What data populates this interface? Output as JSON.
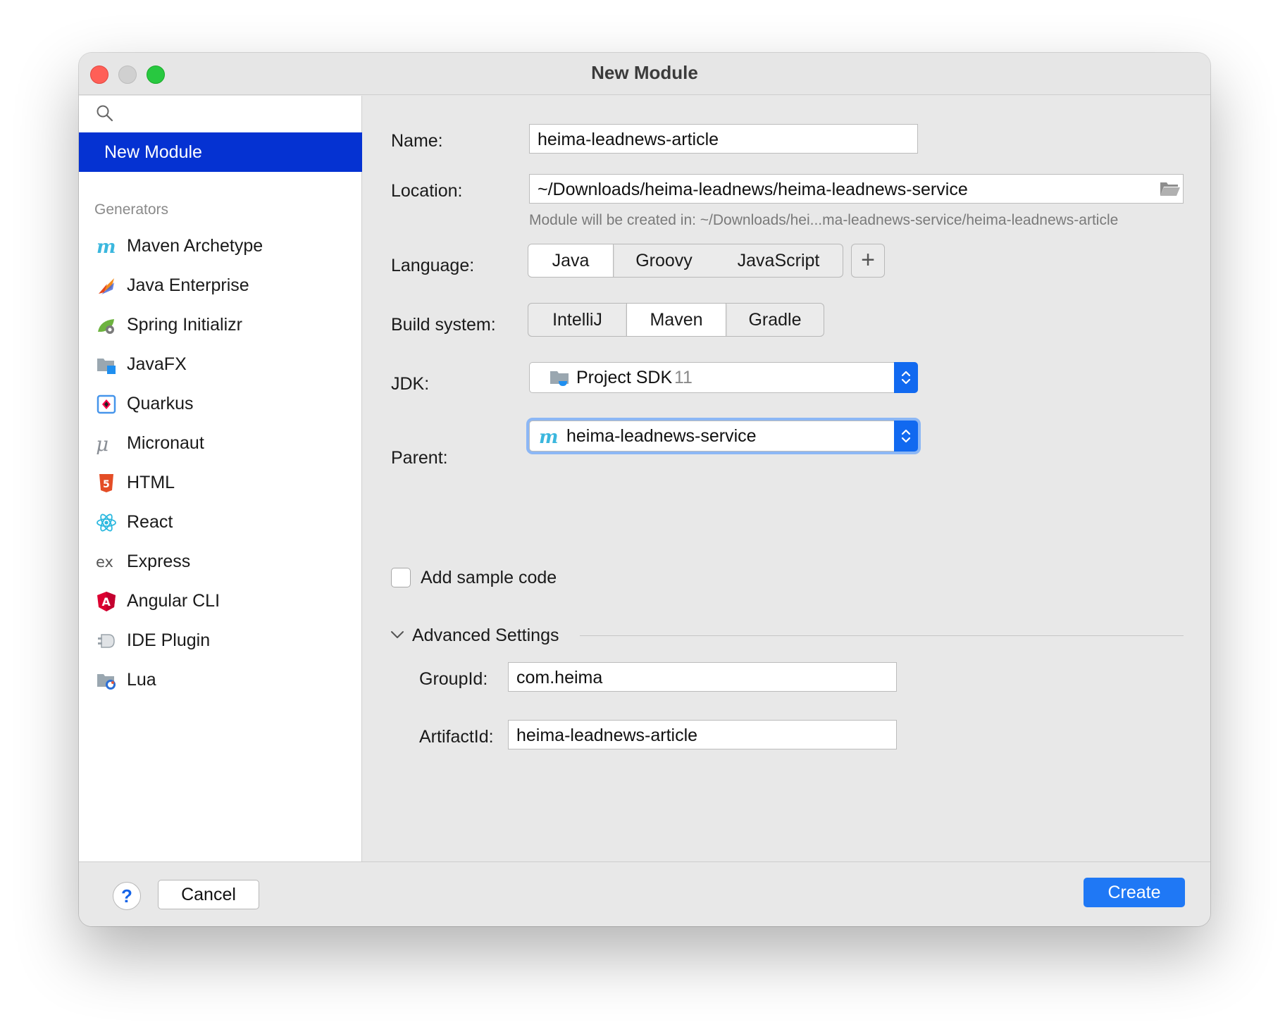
{
  "window": {
    "title": "New Module"
  },
  "sidebar": {
    "selected": "New Module",
    "generators_heading": "Generators",
    "generators": [
      {
        "label": "Maven Archetype",
        "icon": "maven-icon"
      },
      {
        "label": "Java Enterprise",
        "icon": "java-enterprise-icon"
      },
      {
        "label": "Spring Initializr",
        "icon": "spring-icon"
      },
      {
        "label": "JavaFX",
        "icon": "javafx-icon"
      },
      {
        "label": "Quarkus",
        "icon": "quarkus-icon"
      },
      {
        "label": "Micronaut",
        "icon": "micronaut-icon"
      },
      {
        "label": "HTML",
        "icon": "html5-icon"
      },
      {
        "label": "React",
        "icon": "react-icon"
      },
      {
        "label": "Express",
        "icon": "express-icon"
      },
      {
        "label": "Angular CLI",
        "icon": "angular-icon"
      },
      {
        "label": "IDE Plugin",
        "icon": "ide-plugin-icon"
      },
      {
        "label": "Lua",
        "icon": "lua-icon"
      }
    ]
  },
  "form": {
    "name_label": "Name:",
    "name_value": "heima-leadnews-article",
    "location_label": "Location:",
    "location_value": "~/Downloads/heima-leadnews/heima-leadnews-service",
    "location_hint": "Module will be created in: ~/Downloads/hei...ma-leadnews-service/heima-leadnews-article",
    "language_label": "Language:",
    "language_options": [
      "Java",
      "Groovy",
      "JavaScript"
    ],
    "language_selected": "Java",
    "build_label": "Build system:",
    "build_options": [
      "IntelliJ",
      "Maven",
      "Gradle"
    ],
    "build_selected": "Maven",
    "jdk_label": "JDK:",
    "jdk_value": "Project SDK",
    "jdk_version": "11",
    "parent_label": "Parent:",
    "parent_value": "heima-leadnews-service",
    "sample_code_label": "Add sample code",
    "sample_code_checked": false,
    "advanced_label": "Advanced Settings",
    "groupid_label": "GroupId:",
    "groupid_value": "com.heima",
    "artifactid_label": "ArtifactId:",
    "artifactid_value": "heima-leadnews-article"
  },
  "footer": {
    "help_label": "?",
    "cancel_label": "Cancel",
    "create_label": "Create"
  },
  "colors": {
    "accent": "#1f78f5",
    "selection": "#0532d2"
  }
}
